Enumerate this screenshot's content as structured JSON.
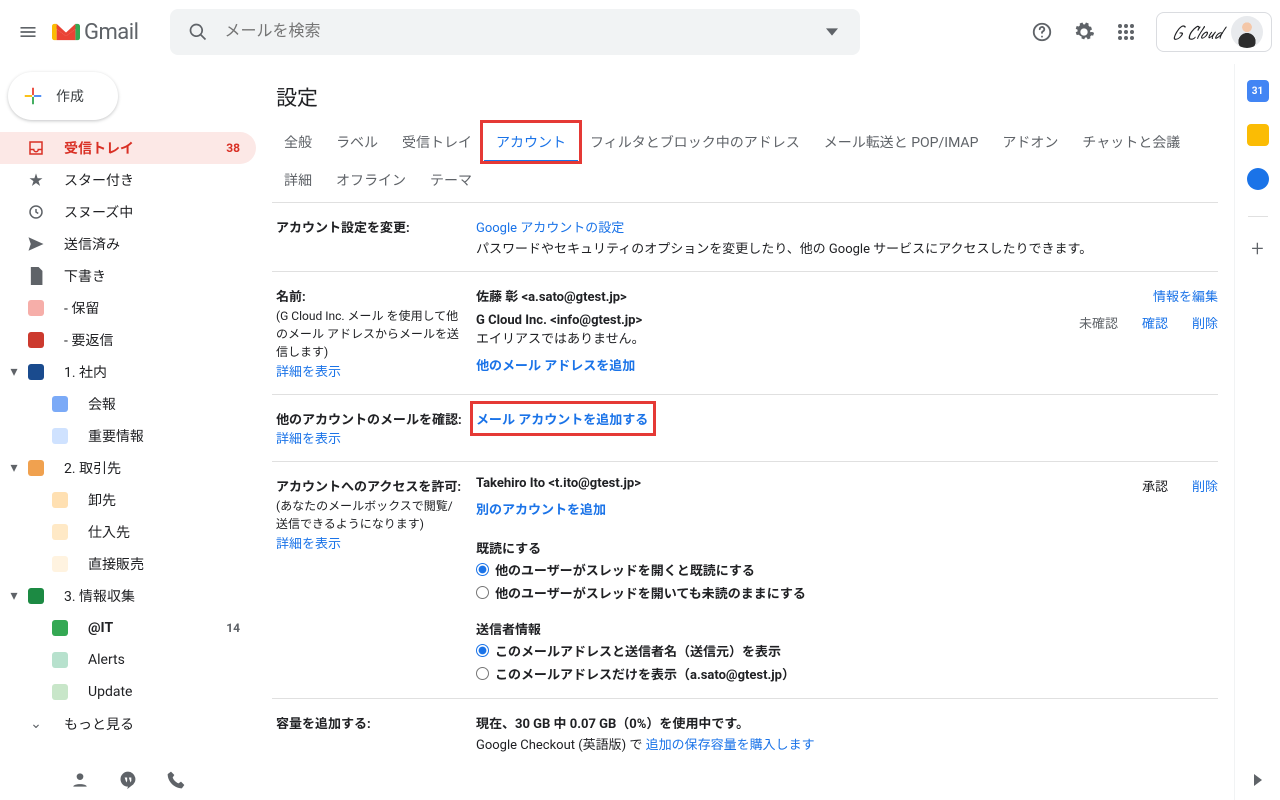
{
  "header": {
    "product": "Gmail",
    "search_placeholder": "メールを検索",
    "account_name": "G Cloud"
  },
  "compose_label": "作成",
  "sidebar": {
    "items": [
      {
        "label": "受信トレイ",
        "count": "38"
      },
      {
        "label": "スター付き"
      },
      {
        "label": "スヌーズ中"
      },
      {
        "label": "送信済み"
      },
      {
        "label": "下書き"
      },
      {
        "label": "- 保留"
      },
      {
        "label": "- 要返信"
      },
      {
        "label": "1. 社内"
      },
      {
        "label": "会報"
      },
      {
        "label": "重要情報"
      },
      {
        "label": "2. 取引先"
      },
      {
        "label": "卸先"
      },
      {
        "label": "仕入先"
      },
      {
        "label": "直接販売"
      },
      {
        "label": "3. 情報収集"
      },
      {
        "label": "@IT",
        "count": "14"
      },
      {
        "label": "Alerts"
      },
      {
        "label": "Update"
      },
      {
        "label": "もっと見る"
      }
    ]
  },
  "settings": {
    "title": "設定",
    "tabs": [
      "全般",
      "ラベル",
      "受信トレイ",
      "アカウント",
      "フィルタとブロック中のアドレス",
      "メール転送と POP/IMAP",
      "アドオン",
      "チャットと会議",
      "詳細",
      "オフライン",
      "テーマ"
    ],
    "active_tab": "アカウント",
    "change_account": {
      "label": "アカウント設定を変更:",
      "link": "Google アカウントの設定",
      "desc": "パスワードやセキュリティのオプションを変更したり、他の Google サービスにアクセスしたりできます。"
    },
    "name": {
      "label": "名前:",
      "desc": "(G Cloud Inc. メール を使用して他のメール アドレスからメールを送信します)",
      "more": "詳細を表示",
      "primary": "佐藤 彰 <a.sato@gtest.jp>",
      "primary_action": "情報を編集",
      "alias": "G Cloud Inc. <info@gtest.jp>",
      "alias_note": "エイリアスではありません。",
      "alias_status": "未確認",
      "alias_confirm": "確認",
      "alias_delete": "削除",
      "add_another": "他のメール アドレスを追加"
    },
    "check_other": {
      "label": "他のアカウントのメールを確認:",
      "more": "詳細を表示",
      "add_link": "メール アカウントを追加する"
    },
    "grant_access": {
      "label": "アカウントへのアクセスを許可:",
      "desc": "(あなたのメールボックスで閲覧/送信できるようになります)",
      "more": "詳細を表示",
      "delegate": "Takehiro Ito <t.ito@gtest.jp>",
      "delegate_status": "承認",
      "delegate_delete": "削除",
      "add_link": "別のアカウントを追加",
      "read_header": "既読にする",
      "read_opt1": "他のユーザーがスレッドを開くと既読にする",
      "read_opt2": "他のユーザーがスレッドを開いても未読のままにする",
      "sender_header": "送信者情報",
      "sender_opt1": "このメールアドレスと送信者名（送信元）を表示",
      "sender_opt2": "このメールアドレスだけを表示（a.sato@gtest.jp）"
    },
    "storage": {
      "label": "容量を追加する:",
      "usage": "現在、30 GB 中 0.07 GB（0%）を使用中です。",
      "prefix": "Google Checkout (英語版) で ",
      "buy_link": "追加の保存容量を購入します"
    }
  },
  "sidepanel": {
    "cal_day": "31"
  }
}
